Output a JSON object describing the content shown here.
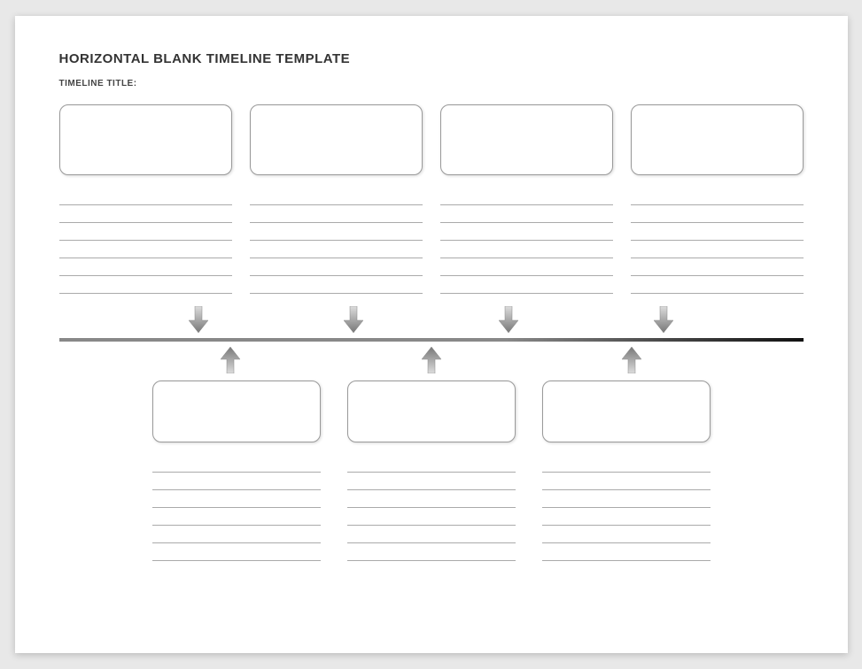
{
  "header": {
    "title": "HORIZONTAL BLANK TIMELINE TEMPLATE",
    "subtitle": "TIMELINE TITLE:"
  },
  "top_events": [
    {
      "box_text": "",
      "lines": [
        "",
        "",
        "",
        "",
        "",
        ""
      ]
    },
    {
      "box_text": "",
      "lines": [
        "",
        "",
        "",
        "",
        "",
        ""
      ]
    },
    {
      "box_text": "",
      "lines": [
        "",
        "",
        "",
        "",
        "",
        ""
      ]
    },
    {
      "box_text": "",
      "lines": [
        "",
        "",
        "",
        "",
        "",
        ""
      ]
    }
  ],
  "bottom_events": [
    {
      "box_text": "",
      "lines": [
        "",
        "",
        "",
        "",
        "",
        ""
      ]
    },
    {
      "box_text": "",
      "lines": [
        "",
        "",
        "",
        "",
        "",
        ""
      ]
    },
    {
      "box_text": "",
      "lines": [
        "",
        "",
        "",
        "",
        "",
        ""
      ]
    }
  ],
  "icons": {
    "arrow_down": "arrow-down-icon",
    "arrow_up": "arrow-up-icon"
  }
}
